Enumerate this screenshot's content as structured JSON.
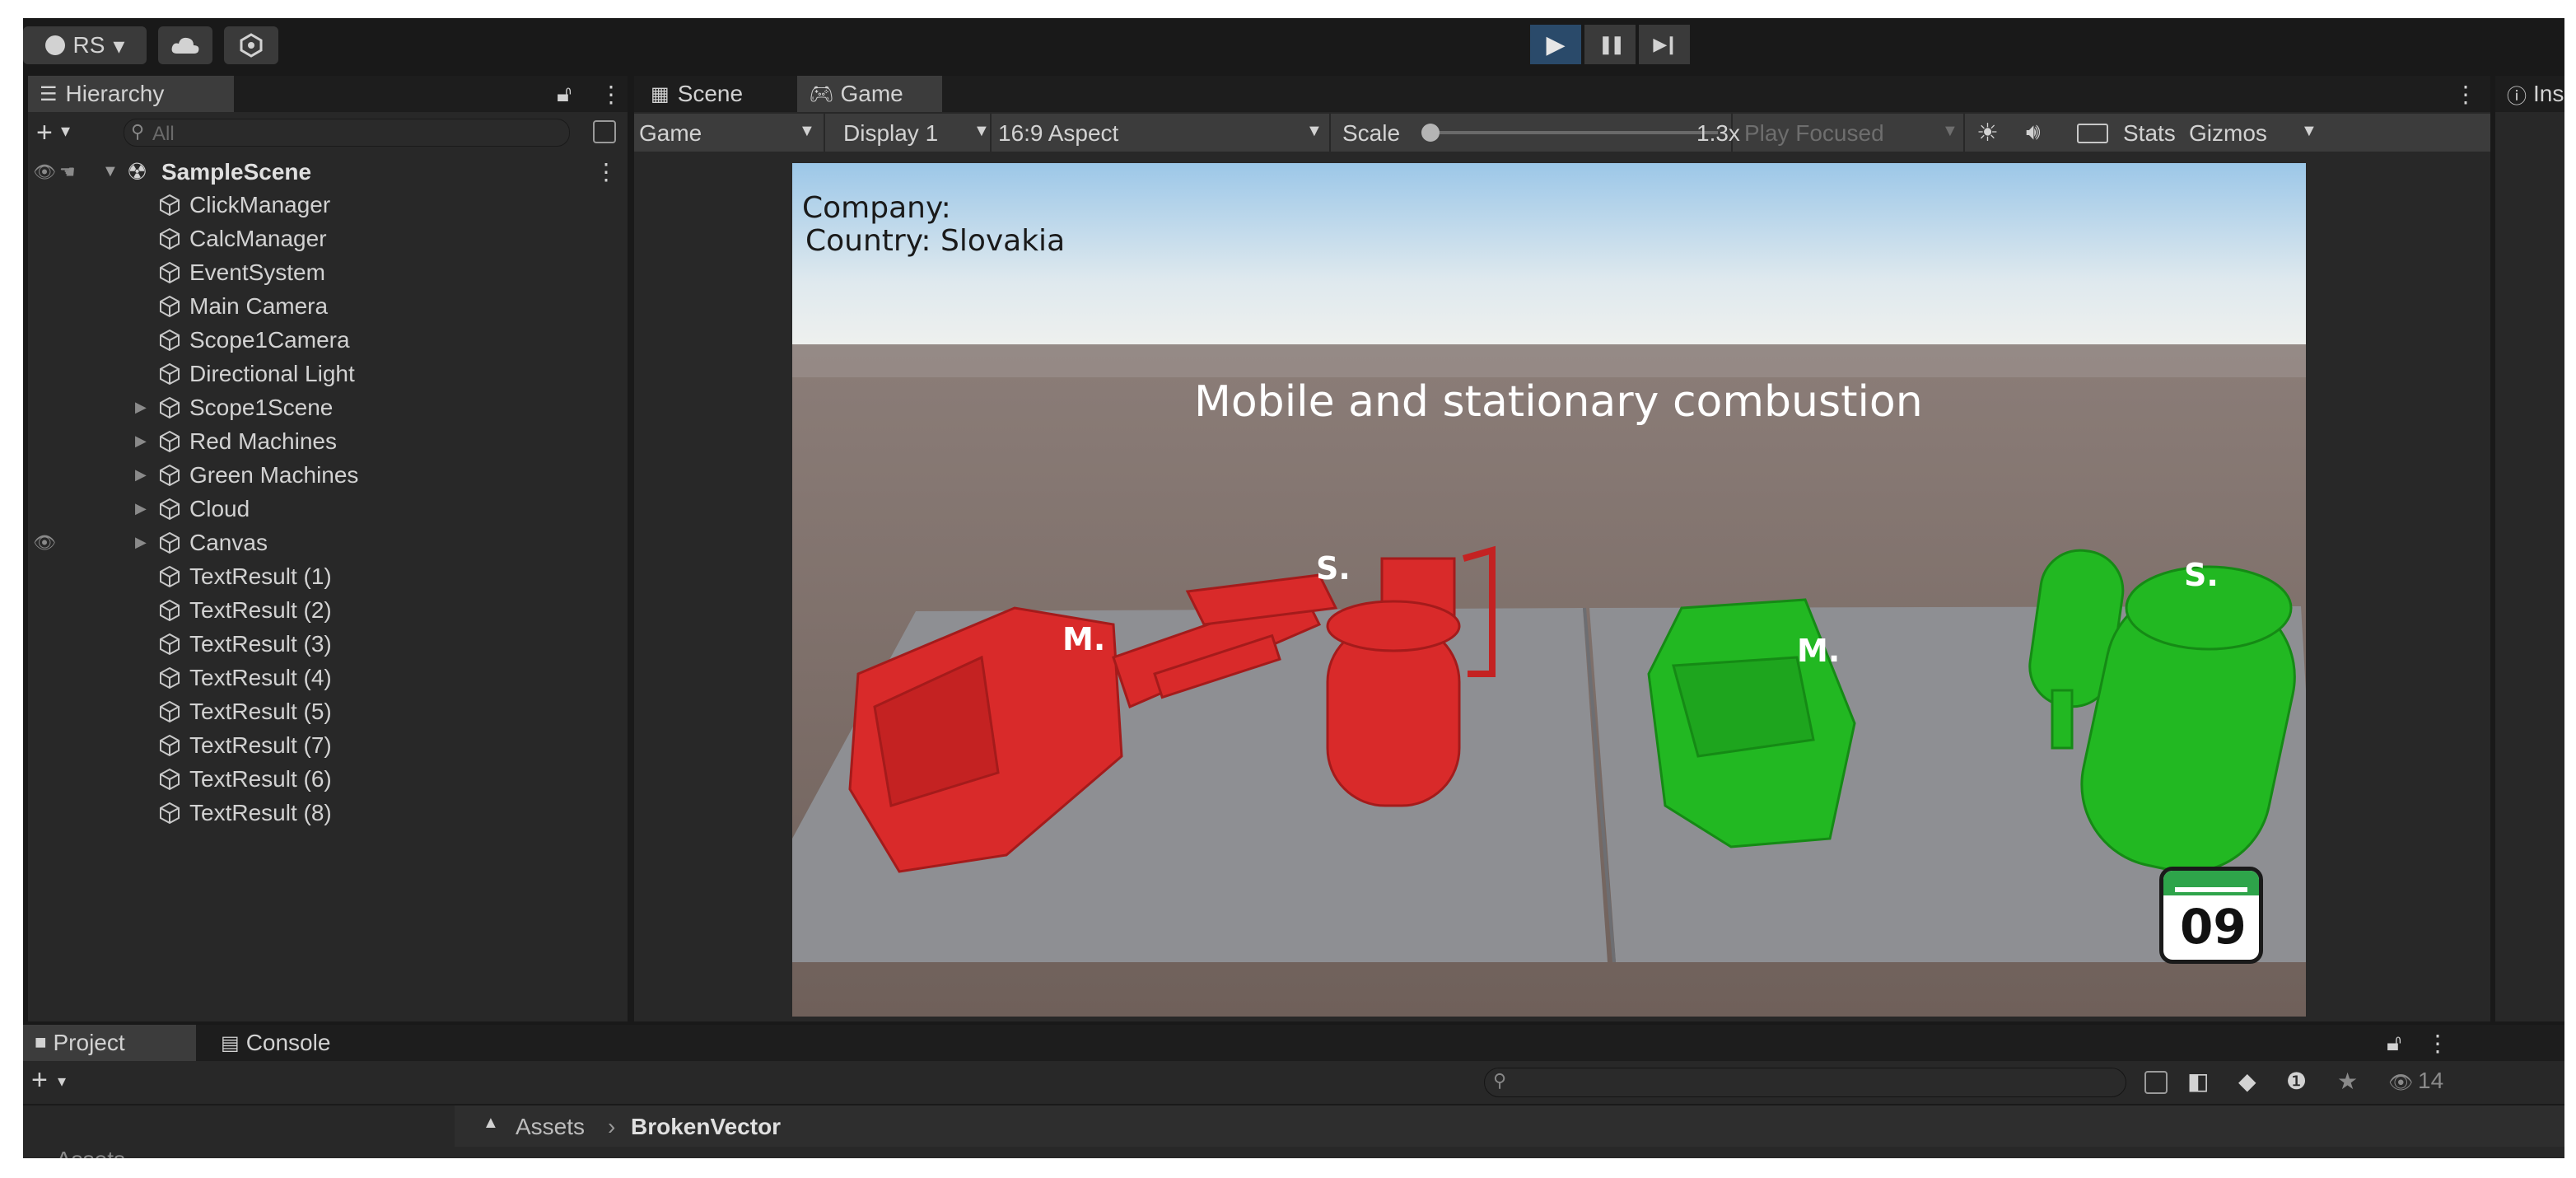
{
  "toolbar": {
    "account_label": "RS",
    "account_dropdown": "▾",
    "cloud_icon": "cloud-icon",
    "settings_icon": "collab-icon",
    "play_icon": "▶",
    "pause_icon": "❚❚",
    "step_icon": "▶❙"
  },
  "hierarchy": {
    "tab_label": "Hierarchy",
    "add_label": "+",
    "add_dropdown": "▾",
    "search_placeholder": "All",
    "scene_name": "SampleScene",
    "items": [
      {
        "label": "ClickManager",
        "expandable": false
      },
      {
        "label": "CalcManager",
        "expandable": false
      },
      {
        "label": "EventSystem",
        "expandable": false
      },
      {
        "label": "Main Camera",
        "expandable": false
      },
      {
        "label": "Scope1Camera",
        "expandable": false
      },
      {
        "label": "Directional Light",
        "expandable": false
      },
      {
        "label": "Scope1Scene",
        "expandable": true
      },
      {
        "label": "Red Machines",
        "expandable": true
      },
      {
        "label": "Green Machines",
        "expandable": true
      },
      {
        "label": "Cloud",
        "expandable": true
      },
      {
        "label": "Canvas",
        "expandable": true
      },
      {
        "label": "TextResult (1)",
        "expandable": false
      },
      {
        "label": "TextResult (2)",
        "expandable": false
      },
      {
        "label": "TextResult (3)",
        "expandable": false
      },
      {
        "label": "TextResult (4)",
        "expandable": false
      },
      {
        "label": "TextResult (5)",
        "expandable": false
      },
      {
        "label": "TextResult (7)",
        "expandable": false
      },
      {
        "label": "TextResult (6)",
        "expandable": false
      },
      {
        "label": "TextResult (8)",
        "expandable": false
      }
    ]
  },
  "game_panel": {
    "tabs": [
      {
        "label": "Scene",
        "icon": "grid-icon"
      },
      {
        "label": "Game",
        "icon": "gamepad-icon"
      }
    ],
    "view_mode": "Game",
    "display": "Display 1",
    "aspect": "16:9 Aspect",
    "scale_label": "Scale",
    "scale_value": "1.3x",
    "scale_fraction": 0.0,
    "play_mode": "Play Focused",
    "stats_label": "Stats",
    "gizmos_label": "Gizmos"
  },
  "game_view": {
    "company_label": "Company:",
    "country_label": "Country: Slovakia",
    "heading": "Mobile and stationary combustion",
    "red_mobile_label": "M.",
    "red_stationary_label": "S.",
    "green_mobile_label": "M.",
    "green_stationary_label": "S.",
    "calendar_day": "09",
    "colors": {
      "red_machine": "#d92a2a",
      "green_machine": "#22b822",
      "sky_top": "#9cc7e8",
      "ground": "#7b6a62",
      "platform": "#8e8f93"
    }
  },
  "inspector": {
    "tab_label": "Insp"
  },
  "bottom_panel": {
    "tabs": [
      {
        "label": "Project",
        "icon": "folder-icon"
      },
      {
        "label": "Console",
        "icon": "console-icon"
      }
    ],
    "add_label": "+",
    "breadcrumb": [
      "Assets",
      "BrokenVector"
    ],
    "hidden_count": "14",
    "tree_root": "Assets"
  },
  "colors": {
    "play_active": "#2a4a6a",
    "panel_bg": "#282828",
    "window_bg": "#191919",
    "text": "#d2d2d2"
  }
}
